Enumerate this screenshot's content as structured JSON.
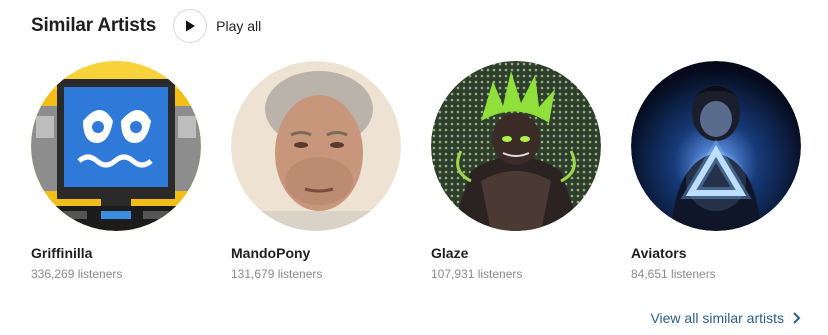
{
  "section": {
    "title": "Similar Artists",
    "play_all_label": "Play all",
    "view_all_label": "View all similar artists"
  },
  "artists": [
    {
      "name": "Griffinilla",
      "listeners": "336,269 listeners"
    },
    {
      "name": "MandoPony",
      "listeners": "131,679 listeners"
    },
    {
      "name": "Glaze",
      "listeners": "107,931 listeners"
    },
    {
      "name": "Aviators",
      "listeners": "84,651 listeners"
    }
  ],
  "icons": {
    "play": "play-icon",
    "chevron": "chevron-right-icon"
  },
  "colors": {
    "link": "#2b5e8c",
    "muted_text": "#8a8a8a"
  }
}
